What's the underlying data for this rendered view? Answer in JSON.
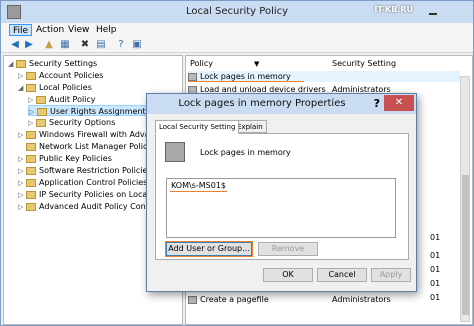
{
  "window": {
    "title": "Local Security Policy",
    "watermark": "IT-KB.RU"
  },
  "menu": [
    "File",
    "Action",
    "View",
    "Help"
  ],
  "toolbar_icons": [
    "back-icon",
    "forward-icon",
    "up-icon",
    "show-tree-icon",
    "delete-icon",
    "properties-icon",
    "help-icon",
    "console-icon"
  ],
  "tree": [
    {
      "label": "Security Settings",
      "level": 0
    },
    {
      "label": "Account Policies",
      "level": 1
    },
    {
      "label": "Local Policies",
      "level": 1
    },
    {
      "label": "Audit Policy",
      "level": 2
    },
    {
      "label": "User Rights Assignment",
      "level": 2
    },
    {
      "label": "Security Options",
      "level": 2
    },
    {
      "label": "Windows Firewall with Advanced",
      "level": 1
    },
    {
      "label": "Network List Manager Policies",
      "level": 1
    },
    {
      "label": "Public Key Policies",
      "level": 1
    },
    {
      "label": "Software Restriction Policies",
      "level": 1
    },
    {
      "label": "Application Control Policies",
      "level": 1
    },
    {
      "label": "IP Security Policies on Local Com",
      "level": 1
    },
    {
      "label": "Advanced Audit Policy Configura",
      "level": 1
    }
  ],
  "list": {
    "headers": [
      "Policy",
      "Security Setting"
    ],
    "rows": [
      {
        "policy": "Lock pages in memory",
        "setting": ""
      },
      {
        "policy": "Load and unload device drivers",
        "setting": "Administrators"
      },
      {
        "policy": "Create a pagefile",
        "setting": "Administrators"
      }
    ],
    "partial": [
      "01",
      "01",
      "01",
      "01",
      "01"
    ]
  },
  "dialog": {
    "title": "Lock pages in memory Properties",
    "help": "?",
    "close": "✕",
    "tabs": [
      "Local Security Setting",
      "Explain"
    ],
    "policy_name": "Lock pages in memory",
    "accounts": [
      "KOM\\s-MS01$"
    ],
    "buttons": {
      "add": "Add User or Group...",
      "remove": "Remove",
      "ok": "OK",
      "cancel": "Cancel",
      "apply": "Apply"
    }
  }
}
